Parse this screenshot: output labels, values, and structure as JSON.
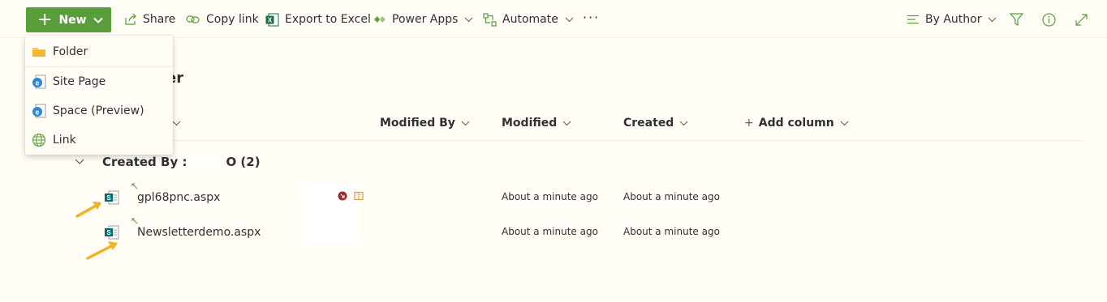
{
  "toolbar": {
    "new_label": "New",
    "share_label": "Share",
    "copy_link_label": "Copy link",
    "export_label": "Export to Excel",
    "power_apps_label": "Power Apps",
    "automate_label": "Automate",
    "more_label": "···",
    "view_label": "By Author"
  },
  "new_menu": {
    "items": [
      {
        "label": "Folder",
        "icon": "folder-icon"
      },
      {
        "label": "Site Page",
        "icon": "site-page-icon"
      },
      {
        "label": "Space (Preview)",
        "icon": "space-icon"
      },
      {
        "label": "Link",
        "icon": "globe-icon"
      }
    ]
  },
  "page": {
    "title_visible": "er"
  },
  "columns": {
    "modified_by": "Modified By",
    "modified": "Modified",
    "created": "Created",
    "add_column": "Add column"
  },
  "group": {
    "label_prefix": "Created By :",
    "label_suffix": "O (2)"
  },
  "files": [
    {
      "name": "gpl68pnc.aspx",
      "modified": "About a minute ago",
      "created": "About a minute ago"
    },
    {
      "name": "Newsletterdemo.aspx",
      "modified": "About a minute ago",
      "created": "About a minute ago"
    }
  ],
  "colors": {
    "accent": "#5a9e3c",
    "background": "#fffdf6",
    "arrow": "#f0b323",
    "alert_red": "#a4262c",
    "checkout_yellow": "#d8a13a"
  }
}
